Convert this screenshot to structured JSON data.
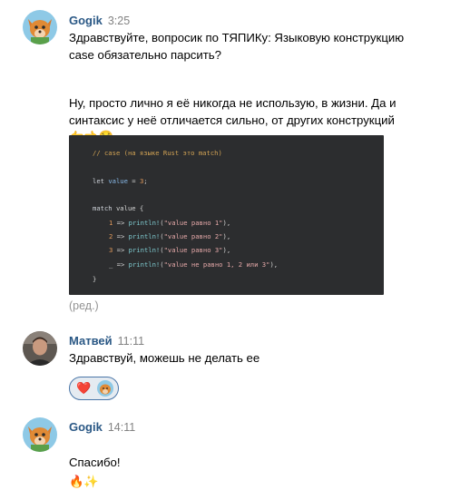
{
  "messages": [
    {
      "author": "Gogik",
      "time": "3:25",
      "text1": "Здравствуйте, вопросик по ТЯПИКу: Языковую конструкцию case обязательно парсить?",
      "text2": "Ну, просто лично я её никогда не использую, в жизни. Да и синтаксис у неё отличается сильно, от других конструкций",
      "emoji": "👉👈🥺",
      "edited": "(ред.)",
      "code": {
        "comment": "// case (на языке Rust это match)",
        "let_kw": "let",
        "let_var": "value",
        "let_rest": " = ",
        "let_num": "3",
        "let_end": ";",
        "match_kw": "match",
        "match_rest": " value {",
        "arms": [
          {
            "pat": "1",
            "mac": "println!",
            "str": "\"value равно 1\""
          },
          {
            "pat": "2",
            "mac": "println!",
            "str": "\"value равно 2\""
          },
          {
            "pat": "3",
            "mac": "println!",
            "str": "\"value равно 3\""
          },
          {
            "pat": "_",
            "mac": "println!",
            "str": "\"value не равно 1, 2 или 3\""
          }
        ],
        "arrow": " => ",
        "close": "}"
      }
    },
    {
      "author": "Матвей",
      "time": "11:11",
      "text": "Здравствуй, можешь не делать ее",
      "reactions": [
        "❤️"
      ]
    },
    {
      "author": "Gogik",
      "time": "14:11",
      "text": "Спасибо!",
      "emoji": "🔥✨"
    }
  ]
}
